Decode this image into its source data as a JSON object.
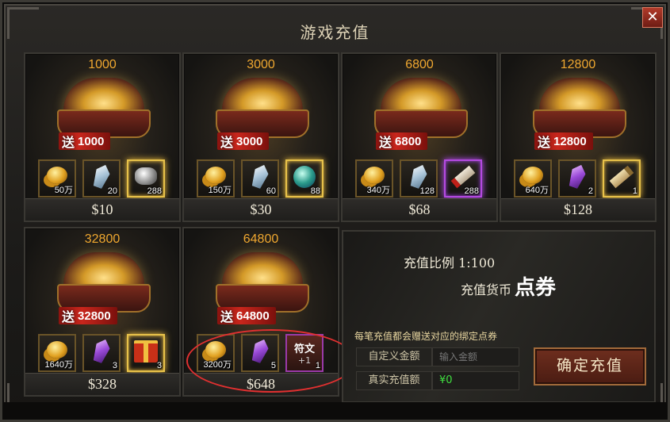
{
  "window": {
    "title": "游戏充值",
    "close_label": "✕"
  },
  "packs": [
    {
      "amount": "1000",
      "gift_label": "送",
      "gift_amount": "1000",
      "price": "$10",
      "items": [
        {
          "icon": "gold-coins-icon",
          "qty": "50万"
        },
        {
          "icon": "white-crystal-icon",
          "qty": "20"
        },
        {
          "icon": "silver-ore-icon",
          "qty": "288"
        }
      ]
    },
    {
      "amount": "3000",
      "gift_label": "送",
      "gift_amount": "3000",
      "price": "$30",
      "items": [
        {
          "icon": "gold-coins-icon",
          "qty": "150万"
        },
        {
          "icon": "white-crystal-icon",
          "qty": "60"
        },
        {
          "icon": "green-orb-icon",
          "qty": "88"
        }
      ]
    },
    {
      "amount": "6800",
      "gift_label": "送",
      "gift_amount": "6800",
      "price": "$68",
      "items": [
        {
          "icon": "gold-coins-icon",
          "qty": "340万"
        },
        {
          "icon": "white-crystal-icon",
          "qty": "128"
        },
        {
          "icon": "red-scroll-icon",
          "qty": "288"
        }
      ]
    },
    {
      "amount": "12800",
      "gift_label": "送",
      "gift_amount": "12800",
      "price": "$128",
      "items": [
        {
          "icon": "gold-coins-icon",
          "qty": "640万"
        },
        {
          "icon": "purple-crystal-icon",
          "qty": "2"
        },
        {
          "icon": "parchment-scroll-icon",
          "qty": "1"
        }
      ]
    },
    {
      "amount": "32800",
      "gift_label": "送",
      "gift_amount": "32800",
      "price": "$328",
      "items": [
        {
          "icon": "gold-coins-icon",
          "qty": "1640万"
        },
        {
          "icon": "purple-crystal-icon",
          "qty": "3"
        },
        {
          "icon": "gift-box-icon",
          "qty": "3"
        }
      ]
    },
    {
      "amount": "64800",
      "gift_label": "送",
      "gift_amount": "64800",
      "price": "$648",
      "items": [
        {
          "icon": "gold-coins-icon",
          "qty": "3200万"
        },
        {
          "icon": "purple-crystal-icon",
          "qty": "5"
        },
        {
          "icon": "rune-icon",
          "label": "符文",
          "plus": "+1",
          "qty": "1"
        }
      ]
    }
  ],
  "info": {
    "ratio": "充值比例 1:100",
    "currency_label": "充值货币",
    "currency_name": "点券",
    "note": "每笔充值都会赠送对应的绑定点券",
    "custom_amount_label": "自定义金额",
    "amount_placeholder": "输入金额",
    "real_amount_label": "真实充值额",
    "real_amount_value": "¥0",
    "confirm_label": "确定充值"
  },
  "colors": {
    "accent_gold": "#f0a830",
    "gift_red": "#c8261c",
    "real_value_green": "#40e040",
    "annotation_red": "#e03030"
  }
}
